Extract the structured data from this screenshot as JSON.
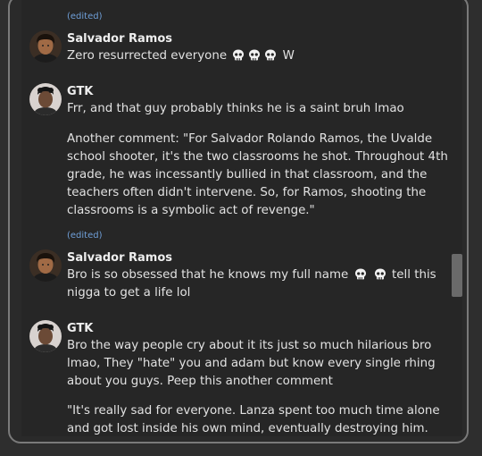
{
  "messages": [
    {
      "edited": "(edited)"
    },
    {
      "author": "Salvador Ramos",
      "text_a": "Zero resurrected everyone",
      "text_b": "W"
    },
    {
      "author": "GTK",
      "p1": "Frr, and that guy probably thinks he is a saint bruh lmao",
      "p2": "Another comment: \"For Salvador Rolando Ramos, the Uvalde school shooter, it's the two classrooms he shot. Throughout 4th grade, he was incessantly bullied in that classroom, and the teachers often didn't intervene. So, for Ramos, shooting the classrooms is a symbolic act of revenge.\"",
      "edited": "(edited)"
    },
    {
      "author": "Salvador Ramos",
      "text_a": "Bro is so obsessed that he knows my full name",
      "text_b": "tell this nigga to get a life lol"
    },
    {
      "author": "GTK",
      "p1": "Bro the way people cry about it its just so much hilarious bro lmao, They \"hate\" you and adam but know every single rhing about you guys. Peep this another comment",
      "p2": "\"It's really sad for everyone. Lanza spent too much time alone and got lost inside his own mind, eventually destroying him. This was"
    }
  ],
  "icons": {
    "emoji": "skull-icon"
  },
  "colors": {
    "background": "#262626",
    "text": "#e2e2e2",
    "edited": "#6f9fd8",
    "scrollbar": "#6a6a6a"
  }
}
